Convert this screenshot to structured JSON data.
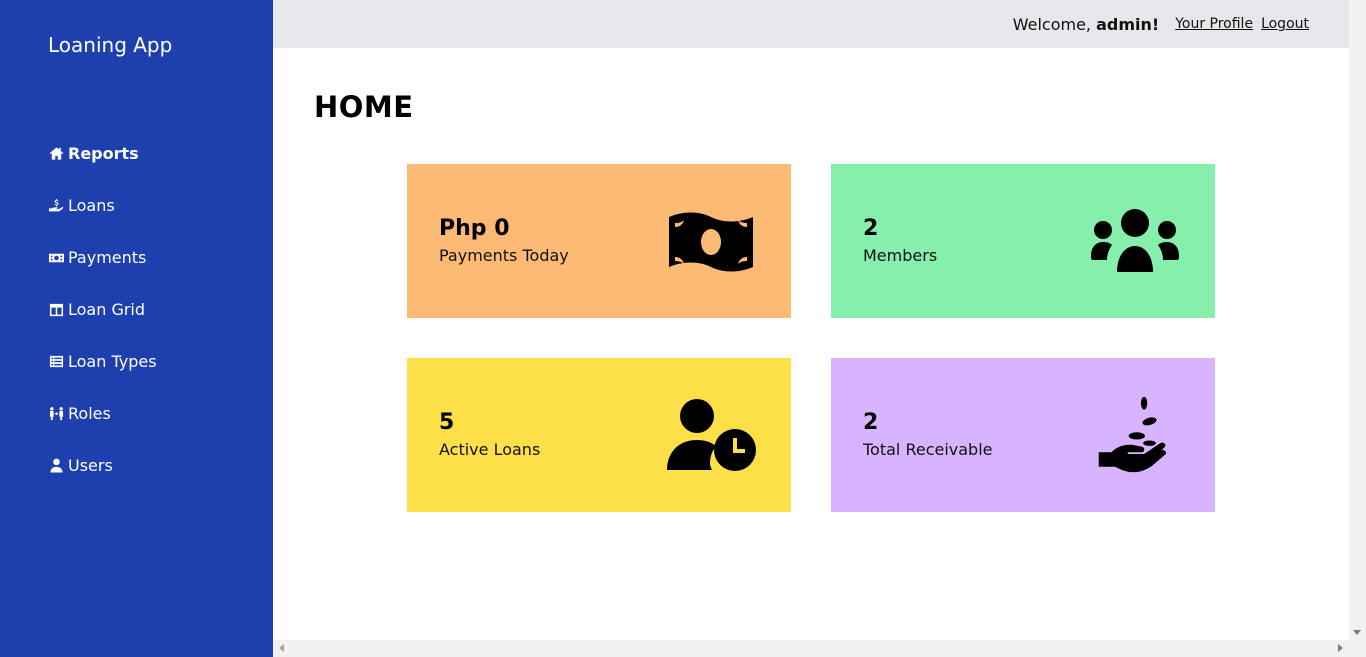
{
  "app": {
    "title": "Loaning App"
  },
  "sidebar": {
    "items": [
      {
        "label": "Reports",
        "icon": "home-icon",
        "active": true
      },
      {
        "label": "Loans",
        "icon": "hand-dollar-icon"
      },
      {
        "label": "Payments",
        "icon": "money-bill-icon"
      },
      {
        "label": "Loan Grid",
        "icon": "grid-icon"
      },
      {
        "label": "Loan Types",
        "icon": "list-icon"
      },
      {
        "label": "Roles",
        "icon": "people-arrows-icon"
      },
      {
        "label": "Users",
        "icon": "user-icon"
      }
    ]
  },
  "header": {
    "welcome_prefix": "Welcome, ",
    "username": "admin!",
    "profile_link": "Your Profile",
    "logout_link": "Logout"
  },
  "main": {
    "title": "HOME",
    "cards": [
      {
        "value": "Php 0",
        "label": "Payments Today",
        "color": "#fdba74",
        "icon": "money-bill-icon"
      },
      {
        "value": "2",
        "label": "Members",
        "color": "#86efac",
        "icon": "users-group-icon"
      },
      {
        "value": "5",
        "label": "Active Loans",
        "color": "#fde047",
        "icon": "user-clock-icon"
      },
      {
        "value": "2",
        "label": "Total Receivable",
        "color": "#d8b4fe",
        "icon": "hand-coins-icon"
      }
    ]
  },
  "colors": {
    "sidebar": "#1e40af",
    "topbar": "#e5e7eb"
  }
}
